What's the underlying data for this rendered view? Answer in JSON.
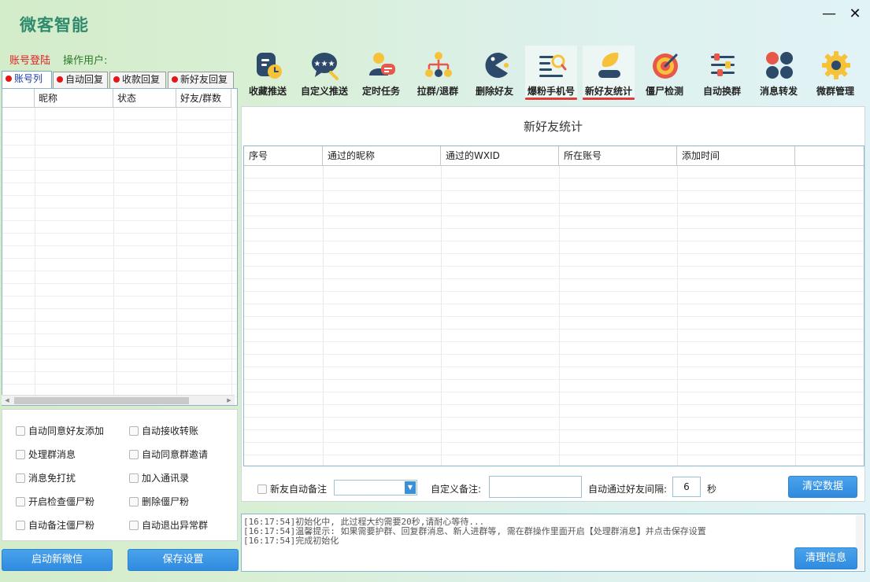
{
  "app": {
    "title": "微客智能",
    "minimize": "—",
    "close": "✕"
  },
  "account": {
    "login": "账号登陆",
    "operator": "操作用户:"
  },
  "left_tabs": [
    {
      "label": "账号列"
    },
    {
      "label": "自动回复"
    },
    {
      "label": "收款回复"
    },
    {
      "label": "新好友回复"
    }
  ],
  "account_table": {
    "columns": [
      "",
      "昵称",
      "状态",
      "好友/群数"
    ]
  },
  "options": [
    {
      "label": "自动同意好友添加"
    },
    {
      "label": "自动接收转账"
    },
    {
      "label": "处理群消息"
    },
    {
      "label": "自动同意群邀请"
    },
    {
      "label": "消息免打扰"
    },
    {
      "label": "加入通讯录"
    },
    {
      "label": "开启检查僵尸粉"
    },
    {
      "label": "删除僵尸粉"
    },
    {
      "label": "自动备注僵尸粉"
    },
    {
      "label": "自动退出异常群"
    }
  ],
  "buttons": {
    "start_wechat": "启动新微信",
    "save_settings": "保存设置",
    "clear_data": "清空数据",
    "clear_info": "清理信息"
  },
  "toolbar": [
    {
      "label": "收藏推送",
      "icon": "bookmark-clock-icon"
    },
    {
      "label": "自定义推送",
      "icon": "chat-stars-icon"
    },
    {
      "label": "定时任务",
      "icon": "user-message-icon"
    },
    {
      "label": "拉群/退群",
      "icon": "org-chart-icon"
    },
    {
      "label": "删除好友",
      "icon": "pacman-icon"
    },
    {
      "label": "爆粉手机号",
      "icon": "list-search-icon"
    },
    {
      "label": "新好友统计",
      "icon": "leaf-user-icon"
    },
    {
      "label": "僵尸检测",
      "icon": "target-icon"
    },
    {
      "label": "自动换群",
      "icon": "sliders-icon"
    },
    {
      "label": "消息转发",
      "icon": "four-dots-icon"
    },
    {
      "label": "微群管理",
      "icon": "gear-icon"
    }
  ],
  "main": {
    "title": "新好友统计",
    "columns": [
      "序号",
      "通过的昵称",
      "通过的WXID",
      "所在账号",
      "添加时间",
      ""
    ],
    "auto_remark_label": "新友自动备注",
    "custom_remark_label": "自定义备注:",
    "interval_label": "自动通过好友间隔:",
    "interval_value": "6",
    "interval_unit": "秒"
  },
  "log": [
    "[16:17:54]初始化中, 此过程大约需要20秒,请耐心等待...",
    "[16:17:54]温馨提示: 如果需要护群、回复群消息、新人进群等, 需在群操作里面开启【处理群消息】并点击保存设置",
    "[16:17:54]完成初始化"
  ],
  "colors": {
    "accent": "#2f8be0",
    "title": "#2f8a6e",
    "login": "#e02424",
    "tab_dot": "#e51616",
    "underline": "#e03a3a"
  }
}
